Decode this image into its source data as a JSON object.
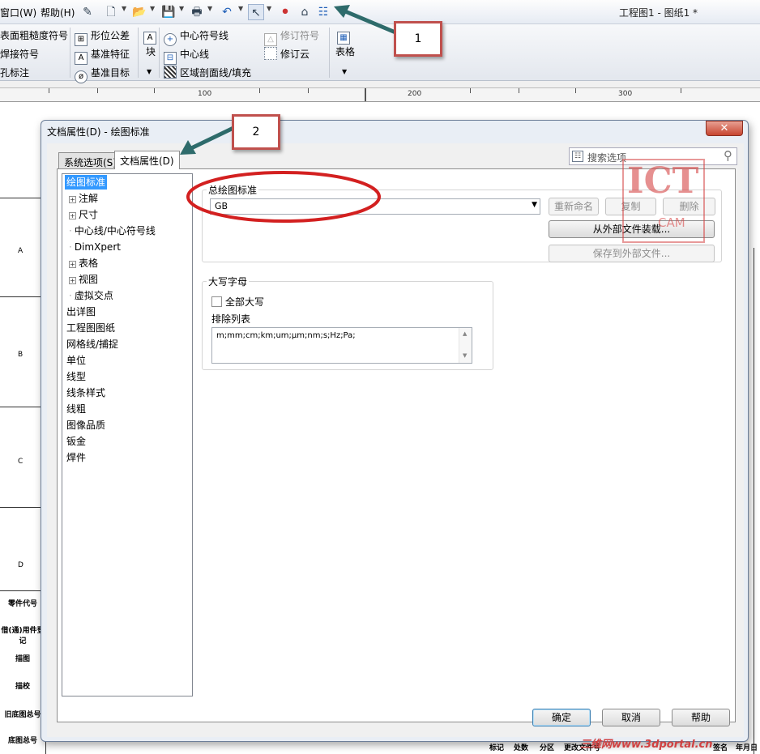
{
  "app": {
    "menu_window": "窗口(W)",
    "menu_help": "帮助(H)",
    "title": "工程图1 - 图纸1 *"
  },
  "ribbon": {
    "surface_finish": "表面粗糙度符号",
    "weld_symbol": "焊接符号",
    "hole_callout": "孔标注",
    "geometric_tolerance": "形位公差",
    "datum_feature": "基准特征",
    "datum_target": "基准目标",
    "block": "块",
    "center_mark": "中心符号线",
    "centerline": "中心线",
    "area_hatch": "区域剖面线/填充",
    "revision_symbol": "修订符号",
    "revision_cloud": "修订云",
    "table": "表格"
  },
  "ruler": {
    "marks": [
      "100",
      "200",
      "300"
    ]
  },
  "drawing": {
    "zones": [
      "A",
      "B",
      "C",
      "D"
    ],
    "title_block": [
      "零件代号",
      "借(通)用件登记",
      "描图",
      "描校",
      "旧底图总号",
      "底图总号"
    ],
    "bottom_labels": [
      "标记",
      "处数",
      "分区",
      "更改文件号",
      "签名",
      "年月日"
    ]
  },
  "dialog": {
    "title": "文档属性(D) - 绘图标准",
    "close": "✕",
    "tabs": [
      "系统选项(S)",
      "文档属性(D)"
    ],
    "search_label": "搜索选项",
    "tree": [
      {
        "label": "绘图标准",
        "expander": false,
        "selected": true,
        "level": 0
      },
      {
        "label": "注解",
        "expander": true,
        "level": 1
      },
      {
        "label": "尺寸",
        "expander": true,
        "level": 1
      },
      {
        "label": "中心线/中心符号线",
        "expander": false,
        "level": 1
      },
      {
        "label": "DimXpert",
        "expander": false,
        "level": 1
      },
      {
        "label": "表格",
        "expander": true,
        "level": 1
      },
      {
        "label": "视图",
        "expander": true,
        "level": 1
      },
      {
        "label": "虚拟交点",
        "expander": false,
        "level": 1
      },
      {
        "label": "出详图",
        "level": 0
      },
      {
        "label": "工程图图纸",
        "level": 0
      },
      {
        "label": "网格线/捕捉",
        "level": 0
      },
      {
        "label": "单位",
        "level": 0
      },
      {
        "label": "线型",
        "level": 0
      },
      {
        "label": "线条样式",
        "level": 0
      },
      {
        "label": "线粗",
        "level": 0
      },
      {
        "label": "图像品质",
        "level": 0
      },
      {
        "label": "钣金",
        "level": 0
      },
      {
        "label": "焊件",
        "level": 0
      }
    ],
    "drafting_standard": {
      "group_title": "总绘图标准",
      "value": "GB",
      "rename": "重新命名",
      "copy": "复制",
      "delete": "删除",
      "load_external": "从外部文件装载...",
      "save_external": "保存到外部文件..."
    },
    "uppercase": {
      "group_title": "大写字母",
      "all_caps": "全部大写",
      "all_caps_checked": false,
      "exclusion_label": "排除列表",
      "exclusion_value": "m;mm;cm;km;um;µm;nm;s;Hz;Pa;"
    },
    "buttons": {
      "ok": "确定",
      "cancel": "取消",
      "help": "帮助"
    }
  },
  "annotations": {
    "callout_1": "1",
    "callout_2": "2",
    "watermark_big": "ICT",
    "watermark_small": "CAM",
    "site": "三维网www.3dportal.cn",
    "accent": "#c0504d",
    "arrow_color": "#2e6b6b"
  }
}
